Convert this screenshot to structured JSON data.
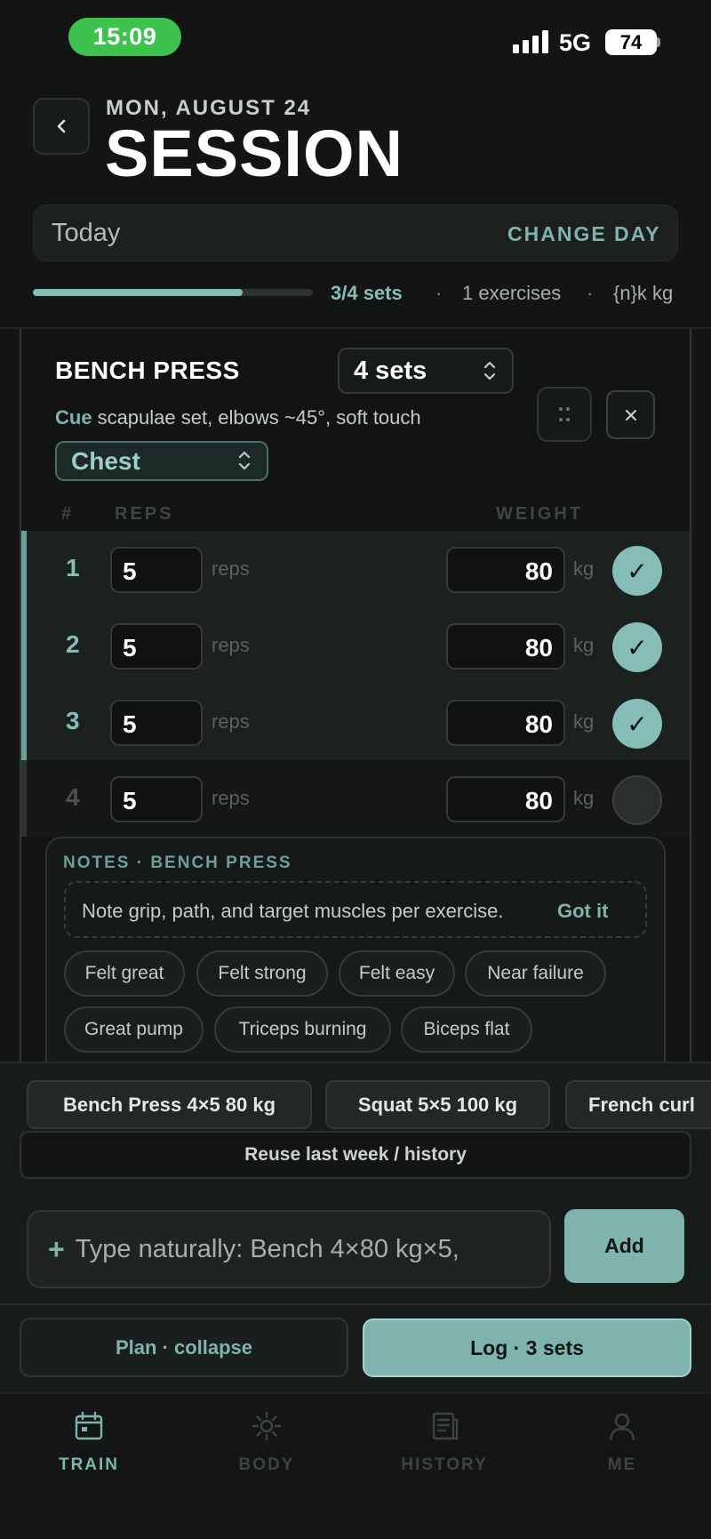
{
  "status_bar": {
    "time": "15:09",
    "network": "5G",
    "battery": "74"
  },
  "header": {
    "date": "MON, AUGUST 24",
    "title": "SESSION",
    "back_icon": "chevron-left-icon"
  },
  "day_bar": {
    "value": "Today",
    "action": "CHANGE DAY"
  },
  "summary": {
    "progress": 0.75,
    "sets": "3/4 sets",
    "dot": "·",
    "exercises": "1 exercises",
    "load": "{n}k kg"
  },
  "exercise": {
    "name": "BENCH PRESS",
    "sets_value": "4 sets",
    "cue_label": "Cue",
    "cue_text": "scapulae set, elbows ~45°, soft touch",
    "muscle": "Chest",
    "columns": {
      "num": "#",
      "reps": "REPS",
      "weight": "WEIGHT"
    },
    "sets": [
      {
        "num": "1",
        "reps": "5",
        "reps_unit": "reps",
        "weight": "80",
        "weight_unit": "kg",
        "done": true,
        "check": "✓"
      },
      {
        "num": "2",
        "reps": "5",
        "reps_unit": "reps",
        "weight": "80",
        "weight_unit": "kg",
        "done": true,
        "check": "✓"
      },
      {
        "num": "3",
        "reps": "5",
        "reps_unit": "reps",
        "weight": "80",
        "weight_unit": "kg",
        "done": true,
        "check": "✓"
      },
      {
        "num": "4",
        "reps": "5",
        "reps_unit": "reps",
        "weight": "80",
        "weight_unit": "kg",
        "done": false,
        "check": ""
      }
    ]
  },
  "notes": {
    "title": "NOTES · BENCH PRESS",
    "hint": "Note grip, path, and target muscles per exercise.",
    "got_it": "Got it",
    "chips": [
      "Felt great",
      "Felt strong",
      "Felt easy",
      "Near failure",
      "Great pump",
      "Triceps burning",
      "Biceps flat"
    ]
  },
  "quick_add": {
    "chips": [
      "Bench Press 4×5 80 kg",
      "Squat 5×5 100 kg",
      "French curl"
    ],
    "reuse": "Reuse last week / history",
    "input_placeholder": "Type naturally: Bench 4×80 kg×5,",
    "add": "Add"
  },
  "actions": {
    "plan": "Plan · collapse",
    "log": "Log · 3 sets"
  },
  "tabs": [
    {
      "label": "TRAIN",
      "icon": "calendar-icon",
      "active": true
    },
    {
      "label": "BODY",
      "icon": "sun-icon",
      "active": false
    },
    {
      "label": "HISTORY",
      "icon": "document-icon",
      "active": false
    },
    {
      "label": "ME",
      "icon": "person-icon",
      "active": false
    }
  ],
  "colors": {
    "accent": "#7fb3ad",
    "background": "#121513",
    "status_green": "#3ec24e"
  }
}
